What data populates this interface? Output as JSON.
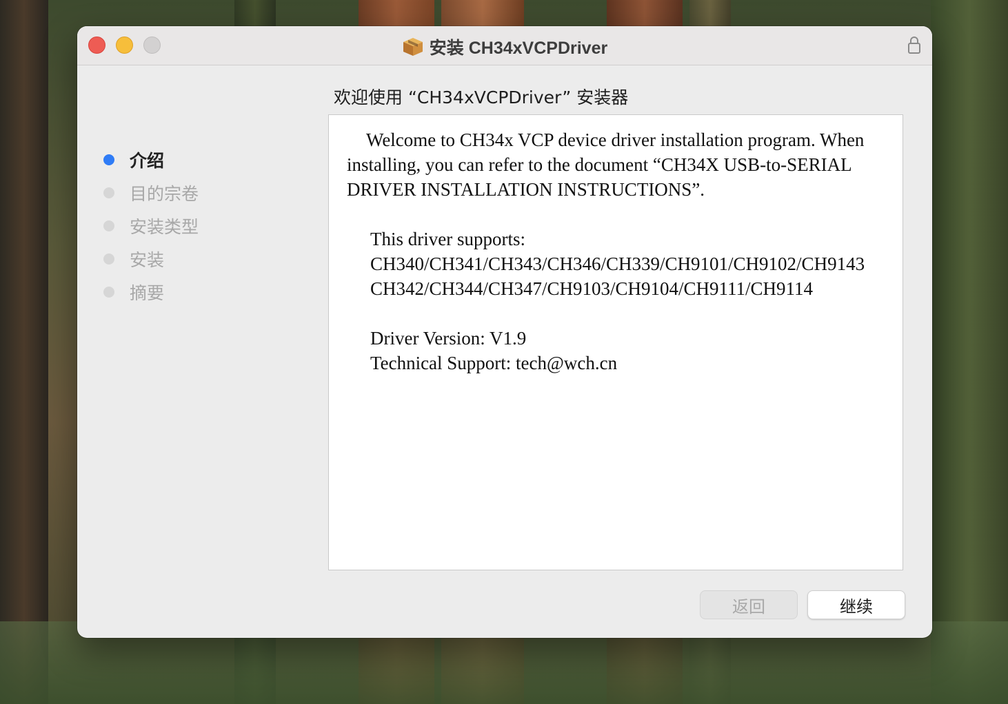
{
  "window": {
    "title": "安装 CH34xVCPDriver",
    "controls": [
      "close",
      "minimize",
      "zoom"
    ],
    "title_icon": "package-icon",
    "lock_icon": "lock-icon"
  },
  "sidebar": {
    "steps": [
      {
        "label": "介绍",
        "active": true
      },
      {
        "label": "目的宗卷",
        "active": false
      },
      {
        "label": "安装类型",
        "active": false
      },
      {
        "label": "安装",
        "active": false
      },
      {
        "label": "摘要",
        "active": false
      }
    ]
  },
  "main": {
    "heading": "欢迎使用 “CH34xVCPDriver” 安装器",
    "intro": "Welcome to CH34x VCP device driver installation program. When installing, you can refer to the document  “CH34X USB-to-SERIAL DRIVER INSTALLATION INSTRUCTIONS”.",
    "supports_label": "This driver supports:",
    "supports_line1": "CH340/CH341/CH343/CH346/CH339/CH9101/CH9102/CH9143",
    "supports_line2": "CH342/CH344/CH347/CH9103/CH9104/CH9111/CH9114",
    "version": "Driver Version: V1.9",
    "support": "Technical Support: tech@wch.cn"
  },
  "buttons": {
    "back_label": "返回",
    "back_enabled": false,
    "continue_label": "继续"
  },
  "colors": {
    "close": "#ee5c54",
    "minimize": "#f6be3b",
    "zoom": "#d3d1d1",
    "active_step": "#2f7cf6"
  }
}
